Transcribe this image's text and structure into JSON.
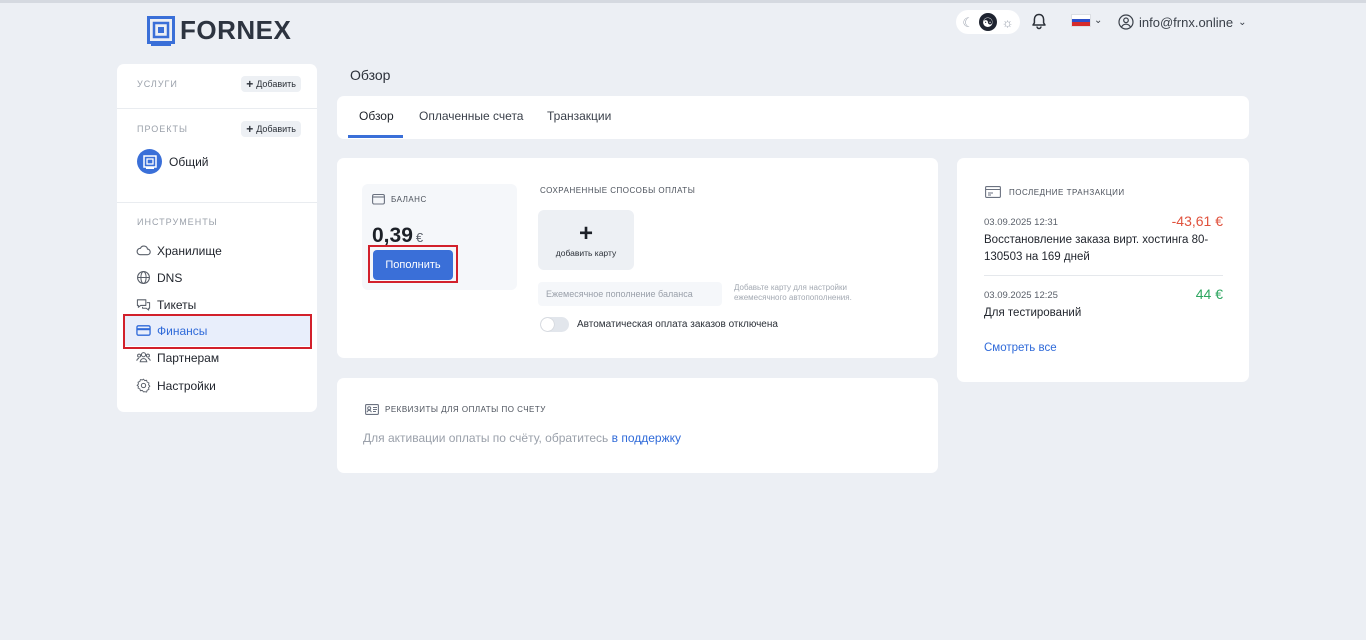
{
  "header": {
    "logo_text": "FORNEX",
    "theme_icons": [
      "moon-icon",
      "yin-yang-icon",
      "sun-icon"
    ],
    "language_flag": "ru-flag",
    "account_email": "info@frnx.online"
  },
  "sidebar": {
    "services_caption": "УСЛУГИ",
    "services_add": "Добавить",
    "projects_caption": "ПРОЕКТЫ",
    "projects_add": "Добавить",
    "project_name": "Общий",
    "tools_caption": "ИНСТРУМЕНТЫ",
    "tools": [
      {
        "label": "Хранилище",
        "icon": "cloud-icon"
      },
      {
        "label": "DNS",
        "icon": "globe-icon"
      },
      {
        "label": "Тикеты",
        "icon": "chat-icon"
      },
      {
        "label": "Финансы",
        "icon": "card-icon",
        "active": true
      },
      {
        "label": "Партнерам",
        "icon": "users-icon"
      },
      {
        "label": "Настройки",
        "icon": "gear-icon"
      }
    ]
  },
  "main": {
    "page_title": "Обзор",
    "tabs": [
      {
        "label": "Обзор",
        "active": true
      },
      {
        "label": "Оплаченные счета"
      },
      {
        "label": "Транзакции"
      }
    ],
    "balance": {
      "caption": "БАЛАНС",
      "amount": "0,39",
      "currency": "€",
      "topup_label": "Пополнить"
    },
    "payment_methods": {
      "caption": "СОХРАНЕННЫЕ СПОСОБЫ ОПЛАТЫ",
      "add_card_plus": "+",
      "add_card_label": "добавить карту",
      "monthly_placeholder": "Ежемесячное пополнение баланса",
      "monthly_hint": "Добавьте карту для настройки ежемесячного автопополнения.",
      "autopay_label": "Автоматическая оплата заказов отключена",
      "autopay_enabled": false
    },
    "requisites": {
      "caption": "РЕКВИЗИТЫ ДЛЯ ОПЛАТЫ ПО СЧЕТУ",
      "text": "Для активации оплаты по счёту, обратитесь",
      "link": "в поддержку"
    }
  },
  "transactions": {
    "caption": "ПОСЛЕДНИЕ ТРАНЗАКЦИИ",
    "items": [
      {
        "date": "03.09.2025 12:31",
        "amount": "-43,61 €",
        "description": "Восстановление заказа вирт. хостинга 80-130503 на 169 дней",
        "color": "#e0523d"
      },
      {
        "date": "03.09.2025 12:25",
        "amount": "44 €",
        "description": "Для тестирований",
        "color": "#2da660"
      }
    ],
    "see_all": "Смотреть все"
  },
  "colors": {
    "accent": "#3a6fd8",
    "highlight": "#d2202b",
    "negative": "#e0523d",
    "positive": "#2da660"
  }
}
